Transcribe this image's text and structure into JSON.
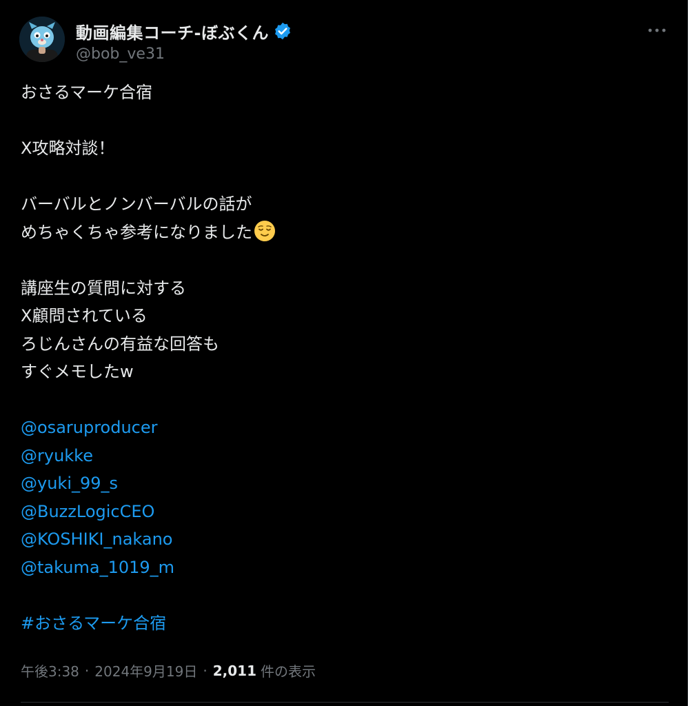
{
  "author": {
    "display_name": "動画編集コーチ-ぼぶくん",
    "handle": "@bob_ve31",
    "verified": true
  },
  "post": {
    "lines": [
      "おさるマーケ合宿",
      "",
      "X攻略対談！",
      "",
      "バーバルとノンバーバルの話が",
      "めちゃくちゃ参考になりました",
      "",
      "講座生の質問に対する",
      "X顧問されている",
      "ろじんさんの有益な回答も",
      "すぐメモしたw",
      ""
    ],
    "emoji": "relieved-face",
    "mentions": [
      "@osaruproducer",
      "@ryukke",
      "@yuki_99_s",
      "@BuzzLogicCEO",
      "@KOSHIKI_nakano",
      "@takuma_1019_m"
    ],
    "hashtag": "#おさるマーケ合宿"
  },
  "meta": {
    "time": "午後3:38",
    "separator": "·",
    "date": "2024年9月19日",
    "views_count": "2,011",
    "views_label": "件の表示"
  },
  "colors": {
    "background": "#000000",
    "text": "#e7e9ea",
    "secondary": "#71767b",
    "accent": "#1d9bf0"
  }
}
